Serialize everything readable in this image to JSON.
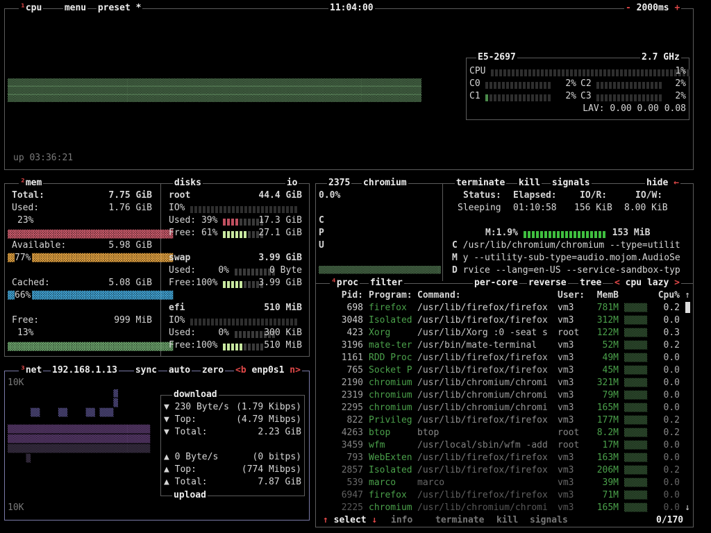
{
  "cpu": {
    "title_key": "¹",
    "title": "cpu",
    "menu": "menu",
    "preset": "preset *",
    "clock": "11:04:00",
    "interval_minus": "-",
    "interval": "2000ms",
    "interval_plus": "+",
    "uptime": "up 03:36:21",
    "model": "E5-2697",
    "freq": "2.7 GHz",
    "total_label": "CPU",
    "total_pct": "1%",
    "cores": [
      {
        "name": "C0",
        "pct": "2%"
      },
      {
        "name": "C2",
        "pct": "2%"
      },
      {
        "name": "C1",
        "pct": "2%"
      },
      {
        "name": "C3",
        "pct": "2%"
      }
    ],
    "lav_label": "LAV:",
    "lav": "0.00 0.00 0.08"
  },
  "mem": {
    "title_key": "²",
    "title": "mem",
    "total_label": "Total:",
    "total": "7.75 GiB",
    "used_label": "Used:",
    "used": "1.76 GiB",
    "used_pct": "23%",
    "avail_label": "Available:",
    "avail": "5.98 GiB",
    "avail_pct": "77%",
    "cached_label": "Cached:",
    "cached": "5.08 GiB",
    "cached_pct": "66%",
    "free_label": "Free:",
    "free": "999 MiB",
    "free_pct": "13%"
  },
  "disks": {
    "title": "disks",
    "io": "io",
    "items": [
      {
        "name": "root",
        "size": "44.4 GiB",
        "io_label": "IO%",
        "used_label": "Used:",
        "used_pct": "39%",
        "used": "17.3 GiB",
        "free_label": "Free:",
        "free_pct": "61%",
        "free": "27.1 GiB"
      },
      {
        "name": "swap",
        "size": "3.99 GiB",
        "used_label": "Used:",
        "used_pct": "0%",
        "used": "0 Byte",
        "free_label": "Free:",
        "free_pct": "100%",
        "free": "3.99 GiB"
      },
      {
        "name": "efi",
        "size": "510 MiB",
        "io_label": "IO%",
        "used_label": "Used:",
        "used_pct": "0%",
        "used": "300 KiB",
        "free_label": "Free:",
        "free_pct": "100%",
        "free": "510 MiB"
      }
    ]
  },
  "net": {
    "title_key": "³",
    "title": "net",
    "ip": "192.168.1.13",
    "sync": "sync",
    "auto": "auto",
    "zero": "zero",
    "prev": "<b",
    "iface": "enp0s1",
    "next": "n>",
    "scale_top": "10K",
    "scale_bottom": "10K",
    "download_title": "download",
    "download": [
      {
        "arrow": "▼",
        "label": "230 Byte/s",
        "value": "(1.79 Kibps)"
      },
      {
        "arrow": "▼",
        "label": "Top:",
        "value": "(4.79 Mibps)"
      },
      {
        "arrow": "▼",
        "label": "Total:",
        "value": "2.23 GiB"
      }
    ],
    "upload_title": "upload",
    "upload": [
      {
        "arrow": "▲",
        "label": "0 Byte/s",
        "value": "(0 bitps)"
      },
      {
        "arrow": "▲",
        "label": "Top:",
        "value": "(774 Mibps)"
      },
      {
        "arrow": "▲",
        "label": "Total:",
        "value": "7.87 GiB"
      }
    ]
  },
  "detail": {
    "pid": "2375",
    "name": "chromium",
    "cpu_pct": "0.0%",
    "cpu_letters": [
      "C",
      "P",
      "U"
    ],
    "terminate": "terminate",
    "kill": "kill",
    "signals": "signals",
    "hide": "hide",
    "status_h": "Status:",
    "elapsed_h": "Elapsed:",
    "ior_h": "IO/R:",
    "iow_h": "IO/W:",
    "status": "Sleeping",
    "elapsed": "01:10:58",
    "ior": "156 KiB",
    "iow": "8.00 KiB",
    "mem_label": "M:1.9%",
    "mem_value": "153 MiB",
    "cmd_letters": [
      "C",
      "M",
      "D"
    ],
    "cmd_lines": [
      "/usr/lib/chromium/chromium --type=utilit",
      "y --utility-sub-type=audio.mojom.AudioSe",
      "rvice --lang=en-US --service-sandbox-typ"
    ]
  },
  "proc": {
    "title_key": "⁴",
    "title": "proc",
    "filter": "filter",
    "per_core": "per-core",
    "reverse": "reverse",
    "tree": "tree",
    "sort_prev": "<",
    "sort": "cpu lazy",
    "sort_next": ">",
    "headers": {
      "pid": "Pid:",
      "program": "Program:",
      "command": "Command:",
      "user": "User:",
      "memb": "MemB",
      "cpu": "Cpu%"
    },
    "rows": [
      {
        "pid": "698",
        "program": "firefox",
        "command": "/usr/lib/firefox/firefox",
        "user": "vm3",
        "mem": "781M",
        "cpu": "0.2"
      },
      {
        "pid": "3048",
        "program": "Isolated",
        "command": "/usr/lib/firefox/firefox",
        "user": "vm3",
        "mem": "312M",
        "cpu": "0.0"
      },
      {
        "pid": "423",
        "program": "Xorg",
        "command": "/usr/lib/Xorg :0 -seat s",
        "user": "root",
        "mem": "122M",
        "cpu": "0.3"
      },
      {
        "pid": "3196",
        "program": "mate-ter",
        "command": "/usr/bin/mate-terminal",
        "user": "vm3",
        "mem": "52M",
        "cpu": "0.2"
      },
      {
        "pid": "1161",
        "program": "RDD Proc",
        "command": "/usr/lib/firefox/firefox",
        "user": "vm3",
        "mem": "49M",
        "cpu": "0.0"
      },
      {
        "pid": "765",
        "program": "Socket P",
        "command": "/usr/lib/firefox/firefox",
        "user": "vm3",
        "mem": "45M",
        "cpu": "0.0"
      },
      {
        "pid": "2190",
        "program": "chromium",
        "command": "/usr/lib/chromium/chromi",
        "user": "vm3",
        "mem": "321M",
        "cpu": "0.0"
      },
      {
        "pid": "2319",
        "program": "chromium",
        "command": "/usr/lib/chromium/chromi",
        "user": "vm3",
        "mem": "79M",
        "cpu": "0.0"
      },
      {
        "pid": "2295",
        "program": "chromium",
        "command": "/usr/lib/chromium/chromi",
        "user": "vm3",
        "mem": "165M",
        "cpu": "0.0"
      },
      {
        "pid": "822",
        "program": "Privileg",
        "command": "/usr/lib/firefox/firefox",
        "user": "vm3",
        "mem": "177M",
        "cpu": "0.2"
      },
      {
        "pid": "4263",
        "program": "btop",
        "command": "btop",
        "user": "root",
        "mem": "8.2M",
        "cpu": "0.2"
      },
      {
        "pid": "3459",
        "program": "wfm",
        "command": "/usr/local/sbin/wfm -add",
        "user": "root",
        "mem": "17M",
        "cpu": "0.0"
      },
      {
        "pid": "793",
        "program": "WebExten",
        "command": "/usr/lib/firefox/firefox",
        "user": "vm3",
        "mem": "163M",
        "cpu": "0.0"
      },
      {
        "pid": "2857",
        "program": "Isolated",
        "command": "/usr/lib/firefox/firefox",
        "user": "vm3",
        "mem": "206M",
        "cpu": "0.2"
      },
      {
        "pid": "539",
        "program": "marco",
        "command": "marco",
        "user": "vm3",
        "mem": "39M",
        "cpu": "0.0"
      },
      {
        "pid": "6947",
        "program": "firefox",
        "command": "/usr/lib/firefox/firefox",
        "user": "vm3",
        "mem": "71M",
        "cpu": "0.0"
      },
      {
        "pid": "2225",
        "program": "chromium",
        "command": "/usr/lib/chromium/chromi",
        "user": "vm3",
        "mem": "165M",
        "cpu": "0.0"
      }
    ],
    "footer": {
      "up": "↑",
      "select": "select",
      "down": "↓",
      "info": "info",
      "terminate": "terminate",
      "kill": "kill",
      "signals": "signals",
      "count": "0/170"
    }
  }
}
